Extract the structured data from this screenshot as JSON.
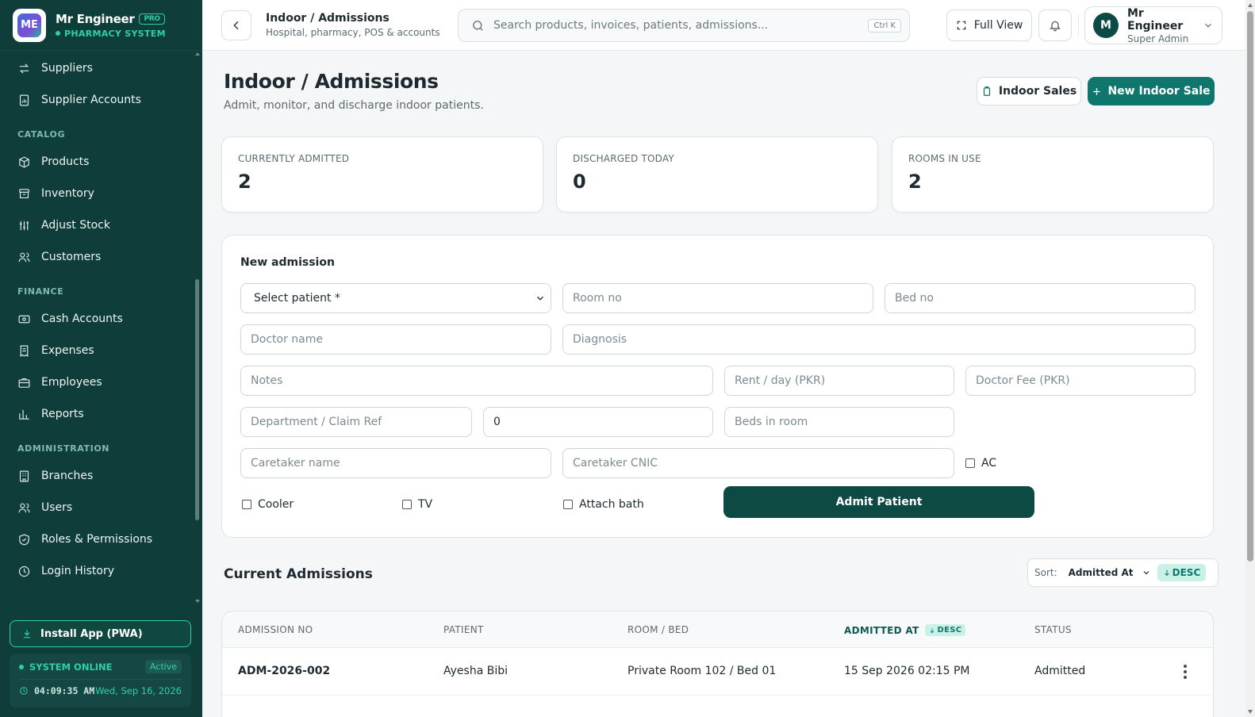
{
  "brand": {
    "name": "Mr Engineer",
    "badge": "PRO",
    "subtitle": "PHARMACY SYSTEM",
    "logo_text": "ME"
  },
  "sidebar": {
    "items_top": [
      {
        "label": "Suppliers",
        "icon": "arrows-swap-icon"
      },
      {
        "label": "Supplier Accounts",
        "icon": "document-chart-icon"
      }
    ],
    "catalog_title": "CATALOG",
    "catalog": [
      {
        "label": "Products",
        "icon": "box-icon"
      },
      {
        "label": "Inventory",
        "icon": "archive-icon"
      },
      {
        "label": "Adjust Stock",
        "icon": "sliders-icon"
      },
      {
        "label": "Customers",
        "icon": "users-icon"
      }
    ],
    "finance_title": "FINANCE",
    "finance": [
      {
        "label": "Cash Accounts",
        "icon": "cash-icon"
      },
      {
        "label": "Expenses",
        "icon": "receipt-icon"
      },
      {
        "label": "Employees",
        "icon": "briefcase-icon"
      },
      {
        "label": "Reports",
        "icon": "bar-chart-icon"
      }
    ],
    "admin_title": "ADMINISTRATION",
    "admin": [
      {
        "label": "Branches",
        "icon": "building-icon"
      },
      {
        "label": "Users",
        "icon": "users-icon"
      },
      {
        "label": "Roles & Permissions",
        "icon": "shield-check-icon"
      },
      {
        "label": "Login History",
        "icon": "clock-icon"
      }
    ],
    "install_label": "Install App (PWA)",
    "status_label": "SYSTEM ONLINE",
    "status_badge": "Active",
    "time": "04:09:35 AM",
    "date": "Wed, Sep 16, 2026"
  },
  "topbar": {
    "title": "Indoor / Admissions",
    "subtitle": "Hospital, pharmacy, POS & accounts",
    "search_placeholder": "Search products, invoices, patients, admissions...",
    "shortcut": "Ctrl K",
    "fullview_label": "Full View",
    "user_initial": "M",
    "user_name": "Mr Engineer",
    "user_role": "Super Admin"
  },
  "page": {
    "title": "Indoor / Admissions",
    "subtitle": "Admit, monitor, and discharge indoor patients.",
    "indoor_sales_label": "Indoor Sales",
    "new_sale_label": "New Indoor Sale"
  },
  "stats": [
    {
      "label": "CURRENTLY ADMITTED",
      "value": "2"
    },
    {
      "label": "DISCHARGED TODAY",
      "value": "0"
    },
    {
      "label": "ROOMS IN USE",
      "value": "2"
    }
  ],
  "form": {
    "title": "New admission",
    "patient_select": "Select patient *",
    "room_placeholder": "Room no",
    "bed_placeholder": "Bed no",
    "doctor_placeholder": "Doctor name",
    "diagnosis_placeholder": "Diagnosis",
    "notes_placeholder": "Notes",
    "rent_placeholder": "Rent / day (PKR)",
    "doctor_fee_placeholder": "Doctor Fee (PKR)",
    "department_placeholder": "Department / Claim Ref",
    "numeric_value": "0",
    "beds_placeholder": "Beds in room",
    "caretaker_placeholder": "Caretaker name",
    "caretaker_cnic_placeholder": "Caretaker CNIC",
    "ac_label": "AC",
    "cooler_label": "Cooler",
    "tv_label": "TV",
    "bath_label": "Attach bath",
    "submit_label": "Admit Patient"
  },
  "admissions": {
    "title": "Current Admissions",
    "sort_label": "Sort:",
    "sort_value": "Admitted At",
    "sort_dir": "DESC",
    "columns": [
      "ADMISSION NO",
      "PATIENT",
      "ROOM / BED",
      "ADMITTED AT",
      "STATUS"
    ],
    "rows": [
      {
        "no": "ADM-2026-002",
        "patient": "Ayesha Bibi",
        "room": "Private Room 102 / Bed 01",
        "admitted": "15 Sep 2026 02:15 PM",
        "status": "Admitted"
      }
    ]
  },
  "colors": {
    "sidebar": "#0e3d3a",
    "accent": "#0f766e",
    "accent_light": "#2fd0a8"
  }
}
